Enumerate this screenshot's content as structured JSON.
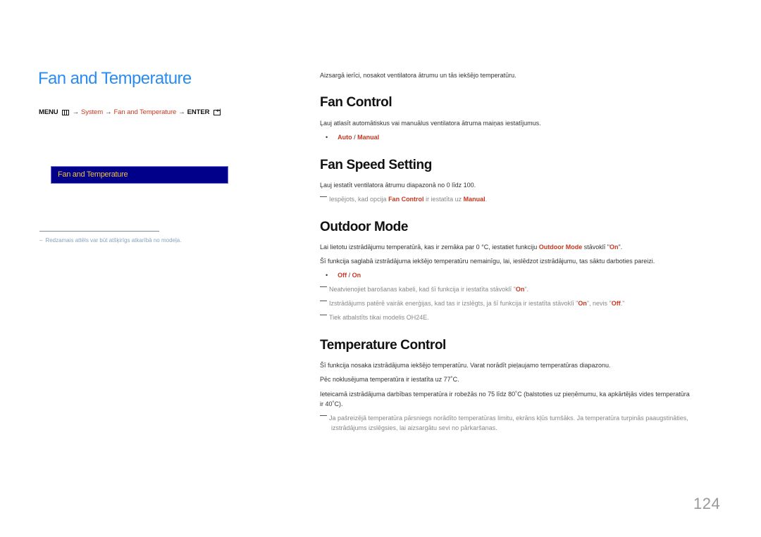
{
  "page": {
    "title": "Fan and Temperature",
    "page_number": "124"
  },
  "menu_path": {
    "menu": "MENU",
    "menu_icon": "menu-icon",
    "arrow": "→",
    "system": "System",
    "fan_and_temperature": "Fan and Temperature",
    "enter": "ENTER",
    "enter_icon": "enter-icon"
  },
  "osd": {
    "label": "Fan and Temperature"
  },
  "footnote": {
    "dash": "–",
    "text": "Redzamais attēls var būt atšķirīgs atkarībā no modeļa."
  },
  "intro": "Aizsargā ierīci, nosakot ventilatora ātrumu un tās iekšējo temperatūru.",
  "fan_control": {
    "heading": "Fan Control",
    "desc": "Ļauj atlasīt automātiskus vai manuālus ventilatora ātruma maiņas iestatījumus.",
    "option_a": "Auto",
    "sep": " / ",
    "option_b": "Manual"
  },
  "fan_speed": {
    "heading": "Fan Speed Setting",
    "desc": "Ļauj iestatīt ventilatora ātrumu diapazonā no 0 līdz 100.",
    "note_pre": "Iespējots, kad opcija ",
    "note_option": "Fan Control",
    "note_mid": " ir iestatīta uz ",
    "note_value": "Manual",
    "note_end": "."
  },
  "outdoor_mode": {
    "heading": "Outdoor Mode",
    "desc1_pre": "Lai lietotu izstrādājumu temperatūrā, kas ir zemāka par 0 °C, iestatiet funkciju ",
    "desc1_option": "Outdoor Mode",
    "desc1_mid": " stāvoklī \"",
    "desc1_value": "On",
    "desc1_end": "\".",
    "desc2": "Šī funkcija saglabā izstrādājuma iekšējo temperatūru nemainīgu, lai, ieslēdzot izstrādājumu, tas sāktu darboties pareizi.",
    "option_a": "Off",
    "sep": " / ",
    "option_b": "On",
    "note1_pre": "Neatvienojiet barošanas kabeli, kad šī funkcija ir iestatīta stāvoklī \"",
    "note1_value": "On",
    "note1_end": "\".",
    "note2_pre": "Izstrādājums patērē vairāk enerģijas, kad tas ir izslēgts, ja šī funkcija ir iestatīta stāvoklī \"",
    "note2_value1": "On",
    "note2_mid": "\", nevis \"",
    "note2_value2": "Off",
    "note2_end": ".\"",
    "note3": "Tiek atbalstīts tikai modelis OH24E."
  },
  "temperature_control": {
    "heading": "Temperature Control",
    "desc1": "Šī funkcija nosaka izstrādājuma iekšējo temperatūru. Varat norādīt pieļaujamo temperatūras diapazonu.",
    "desc2": "Pēc noklusējuma temperatūra ir iestatīta uz 77˚C.",
    "desc3": "Ieteicamā izstrādājuma darbības temperatūra ir robežās no 75 līdz 80˚C (balstoties uz pieņēmumu, ka apkārtējās vides temperatūra ir 40˚C).",
    "note": "Ja pašreizējā temperatūra pārsniegs norādīto temperatūras limitu, ekrāns kļūs tumšāks. Ja temperatūra turpinās paaugstināties, izstrādājums izslēgsies, lai aizsargātu sevi no pārkaršanas."
  }
}
